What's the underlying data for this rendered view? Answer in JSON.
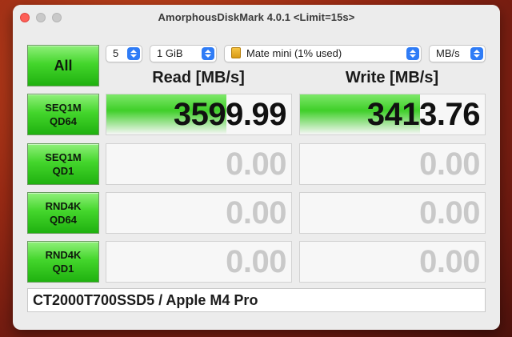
{
  "window": {
    "title": "AmorphousDiskMark 4.0.1 <Limit=15s>"
  },
  "controls": {
    "all_label": "All",
    "count": "5",
    "size": "1 GiB",
    "drive": "Mate mini (1% used)",
    "unit": "MB/s"
  },
  "columns": {
    "read": "Read [MB/s]",
    "write": "Write [MB/s]"
  },
  "tests": [
    {
      "line1": "SEQ1M",
      "line2": "QD64",
      "read": "3599.99",
      "write": "3413.76",
      "read_fill": 0.65,
      "write_fill": 0.65
    },
    {
      "line1": "SEQ1M",
      "line2": "QD1",
      "read": "0.00",
      "write": "0.00",
      "read_fill": 0,
      "write_fill": 0
    },
    {
      "line1": "RND4K",
      "line2": "QD64",
      "read": "0.00",
      "write": "0.00",
      "read_fill": 0,
      "write_fill": 0
    },
    {
      "line1": "RND4K",
      "line2": "QD1",
      "read": "0.00",
      "write": "0.00",
      "read_fill": 0,
      "write_fill": 0
    }
  ],
  "footer": {
    "device": "CT2000T700SSD5 / Apple M4 Pro"
  },
  "colors": {
    "accent_green": "#3fcf29",
    "select_blue": "#2f7cf6",
    "close_red": "#fe5f57"
  }
}
